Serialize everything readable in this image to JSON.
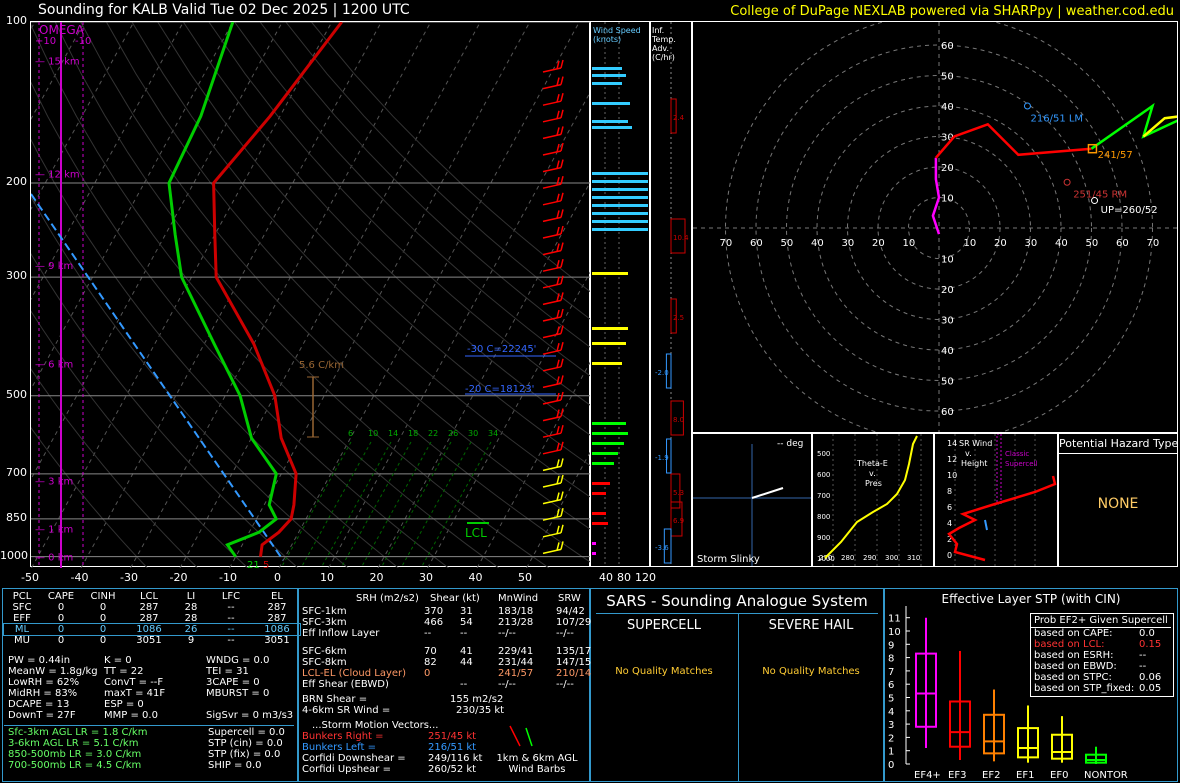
{
  "header": {
    "title": "Sounding for KALB Valid  Tue 02 Dec 2025 | 1200 UTC",
    "credit": "College of DuPage NEXLAB powered via SHARPpy | weather.cod.edu"
  },
  "skewt": {
    "omega_label": "OMEGA",
    "omega_ticks": [
      "+10",
      "-10"
    ],
    "pressure_ticks": [
      "100",
      "200",
      "300",
      "500",
      "700",
      "850",
      "1000"
    ],
    "height_labels": [
      "15 km",
      "12 km",
      "9 km",
      "6 km",
      "3 km",
      "1 km",
      "0 km"
    ],
    "temp_ticks": [
      "-50",
      "-40",
      "-30",
      "-20",
      "-10",
      "0",
      "10",
      "20",
      "30",
      "40",
      "50"
    ],
    "annotations": {
      "lapse": "5.6 C/km",
      "m30": "-30 C=22245'",
      "m20": "-20 C=18123'",
      "lcl": "LCL",
      "sfc_td": "21",
      "sfc_t": "5"
    },
    "mixing_ratios": [
      "6",
      "10",
      "14",
      "18",
      "22",
      "26",
      "30",
      "34"
    ]
  },
  "chart_data": {
    "type": "line",
    "title": "Sounding for KALB Valid  Tue 02 Dec 2025 | 1200 UTC",
    "xlabel": "",
    "ylabel": "",
    "xlim": [
      -50,
      50
    ],
    "ylim": [
      1000,
      100
    ],
    "series": [
      {
        "name": "",
        "color": "#cc0000",
        "x_pressure": [
          1000,
          950,
          900,
          850,
          800,
          700,
          600,
          500,
          400,
          300,
          250,
          200,
          150,
          100
        ],
        "values": [
          -5,
          -6,
          -4,
          -3,
          -4,
          -7,
          -14,
          -20,
          -30,
          -45,
          -50,
          -56,
          -52,
          -48
        ]
      },
      {
        "name": "",
        "color": "#00cc00",
        "x_pressure": [
          1000,
          950,
          900,
          850,
          800,
          700,
          600,
          500,
          400,
          300,
          250,
          200,
          150,
          100
        ],
        "values": [
          -10,
          -13,
          -8,
          -6,
          -9,
          -11,
          -20,
          -27,
          -38,
          -52,
          -58,
          -65,
          -66,
          -70
        ]
      }
    ],
    "hodograph": {
      "rings": [
        10,
        20,
        30,
        40,
        50,
        60,
        70
      ],
      "labels": {
        "lm": "216/51 LM",
        "rm": "251/45 RM",
        "mean": "241/57",
        "up": "UP=260/52"
      },
      "x_ticks": [
        "70",
        "60",
        "50",
        "40",
        "30",
        "20",
        "10",
        "10",
        "20",
        "30",
        "40",
        "50",
        "60",
        "70"
      ],
      "y_ticks": [
        "60",
        "50",
        "40",
        "30",
        "20",
        "10",
        "10",
        "20",
        "30",
        "40",
        "50",
        "60"
      ]
    },
    "stp_effective": {
      "title": "Effective Layer STP (with CIN)",
      "categories": [
        "EF4+",
        "EF3",
        "EF2",
        "EF1",
        "EF0",
        "NONTOR"
      ],
      "y_ticks": [
        "0",
        "1",
        "2",
        "3",
        "4",
        "5",
        "6",
        "7",
        "8",
        "9",
        "10",
        "11"
      ],
      "medians": [
        5.3,
        2.4,
        1.7,
        1.2,
        0.9,
        0.3
      ],
      "q1": [
        2.8,
        1.3,
        0.8,
        0.5,
        0.4,
        0.1
      ],
      "q3": [
        8.3,
        4.7,
        3.7,
        2.7,
        2.2,
        0.7
      ],
      "lo": [
        1.2,
        0.3,
        0.2,
        0.1,
        0.1,
        0
      ],
      "hi": [
        11,
        8.5,
        5.6,
        4.4,
        3.6,
        1.3
      ],
      "colors": [
        "#ff00ff",
        "#ff0000",
        "#ff8000",
        "#ffff00",
        "#ffff00",
        "#00ff00"
      ]
    }
  },
  "side_panels": {
    "wind_speed": {
      "title": "Wind Speed (knots)",
      "ticks": [
        "40",
        "80",
        "120"
      ]
    },
    "temp_adv": {
      "title": "Inf. Temp. Adv. (C/hr)",
      "values": [
        "2.4",
        "10.4",
        "2.5",
        "-2.0",
        "8.0",
        "-1.9",
        "5.3",
        "6.9",
        "-3.6"
      ]
    },
    "storm_slinky": {
      "title": "Storm Slinky",
      "deg": "-- deg"
    },
    "theta_e": {
      "title": "Theta-E v. Pres",
      "y_ticks": [
        "500",
        "600",
        "700",
        "800",
        "900",
        "1000"
      ],
      "x_ticks": [
        "270",
        "280",
        "290",
        "300",
        "310"
      ]
    },
    "sr_wind": {
      "title": "SR Wind v. Height",
      "label": "Classic Supercell",
      "y_ticks": [
        "14",
        "12",
        "10",
        "8",
        "6",
        "4",
        "2",
        "0"
      ]
    },
    "hazard": {
      "title": "Potential Hazard Type",
      "value": "NONE"
    }
  },
  "parcels": {
    "headers": [
      "PCL",
      "CAPE",
      "CINH",
      "LCL",
      "LI",
      "LFC",
      "EL"
    ],
    "rows": [
      [
        "SFC",
        "0",
        "0",
        "287",
        "28",
        "--",
        "287"
      ],
      [
        "EFF",
        "0",
        "0",
        "287",
        "28",
        "--",
        "287"
      ],
      [
        "ML",
        "0",
        "0",
        "1086",
        "26",
        "--",
        "1086"
      ],
      [
        "MU",
        "0",
        "0",
        "3051",
        "9",
        "--",
        "3051"
      ]
    ],
    "indices": [
      [
        "PW = 0.44in",
        "K = 0",
        "WNDG = 0.0"
      ],
      [
        "MeanW = 1.8g/kg",
        "TT = 22",
        "TEI = 31"
      ],
      [
        "LowRH = 62%",
        "ConvT = --F",
        "3CAPE = 0"
      ],
      [
        "MidRH = 83%",
        "maxT = 41F",
        "MBURST = 0"
      ],
      [
        "DCAPE = 13",
        "ESP = 0",
        ""
      ],
      [
        "DownT = 27F",
        "MMP = 0.0",
        "SigSvr = 0 m3/s3"
      ]
    ],
    "lapse_rates": [
      "Sfc-3km AGL LR = 1.8 C/km",
      "3-6km AGL LR = 5.1 C/km",
      "850-500mb LR = 3.0 C/km",
      "700-500mb LR = 4.5 C/km"
    ],
    "composites": [
      "Supercell = 0.0",
      "STP (cin) = 0.0",
      "STP (fix) = 0.0",
      "SHIP = 0.0"
    ]
  },
  "kinematics": {
    "headers": [
      "SRH (m2/s2)",
      "Shear (kt)",
      "MnWind",
      "SRW"
    ],
    "rows": [
      [
        "SFC-1km",
        "370",
        "31",
        "183/18",
        "94/42"
      ],
      [
        "SFC-3km",
        "466",
        "54",
        "213/28",
        "107/29"
      ],
      [
        "Eff Inflow Layer",
        "--",
        "--",
        "--/--",
        "--/--"
      ],
      [
        "SFC-6km",
        "70",
        "41",
        "229/41",
        "135/17"
      ],
      [
        "SFC-8km",
        "82",
        "44",
        "231/44",
        "147/15"
      ],
      [
        "LCL-EL (Cloud Layer)",
        "0",
        "",
        "241/57",
        "210/14"
      ],
      [
        "Eff Shear (EBWD)",
        "",
        "--",
        "--/--",
        "--/--"
      ]
    ],
    "brn": [
      "BRN Shear =",
      "155 m2/s2"
    ],
    "shear46": [
      "4-6km SR Wind =",
      "230/35 kt"
    ],
    "storm_header": "...Storm Motion Vectors...",
    "storm": [
      [
        "Bunkers Right =",
        "251/45 kt"
      ],
      [
        "Bunkers Left =",
        "216/51 kt"
      ],
      [
        "Corfidi Downshear =",
        "249/116 kt"
      ],
      [
        "Corfidi Upshear =",
        "260/52 kt"
      ]
    ],
    "barbs_label": "1km & 6km AGL Wind Barbs"
  },
  "sars": {
    "title": "SARS - Sounding Analogue System",
    "supercell": "SUPERCELL",
    "hail": "SEVERE HAIL",
    "supercell_msg": "No Quality Matches",
    "hail_msg": "No Quality Matches"
  },
  "stp_box": {
    "title": "Prob EF2+ Given Supercell",
    "rows": [
      [
        "based on CAPE:",
        "0.0"
      ],
      [
        "based on LCL:",
        "0.15"
      ],
      [
        "based on ESRH:",
        "--"
      ],
      [
        "based on EBWD:",
        "--"
      ],
      [
        "based on STPC:",
        "0.06"
      ],
      [
        "based on STP_fixed:",
        "0.05"
      ]
    ]
  },
  "colors": {
    "accent": "#3399cc",
    "temp": "#cc0000",
    "dew": "#00cc00",
    "title": "#ffff00"
  }
}
